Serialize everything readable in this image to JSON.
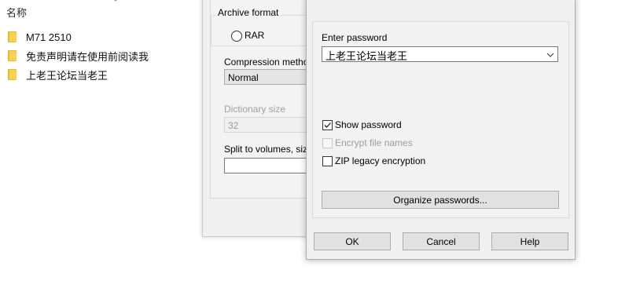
{
  "explorer": {
    "column_header": "名称",
    "files": [
      {
        "name": "M71 2510",
        "icon": "folder-icon"
      },
      {
        "name": "免责声明请在使用前阅读我",
        "icon": "folder-icon"
      },
      {
        "name": "上老王论坛当老王",
        "icon": "folder-icon"
      }
    ]
  },
  "archive_dialog": {
    "archive_format_label": "Archive format",
    "rar_option": "RAR",
    "compression_method_label": "Compression method",
    "compression_method_value": "Normal",
    "dictionary_size_label": "Dictionary size",
    "dictionary_size_value": "32",
    "split_volumes_label": "Split to volumes, size"
  },
  "password_dialog": {
    "enter_password_label": "Enter password",
    "password_value": "上老王论坛当老王",
    "show_password": {
      "label": "Show password",
      "checked": true,
      "enabled": true
    },
    "encrypt_file_names": {
      "label": "Encrypt file names",
      "checked": false,
      "enabled": false
    },
    "zip_legacy": {
      "label": "ZIP legacy encryption",
      "checked": false,
      "enabled": true
    },
    "organize_label": "Organize passwords...",
    "ok_label": "OK",
    "cancel_label": "Cancel",
    "help_label": "Help"
  },
  "colors": {
    "folder": "#f7d25a",
    "dialog_bg": "#f0f0f0",
    "button_bg": "#e1e1e1"
  }
}
